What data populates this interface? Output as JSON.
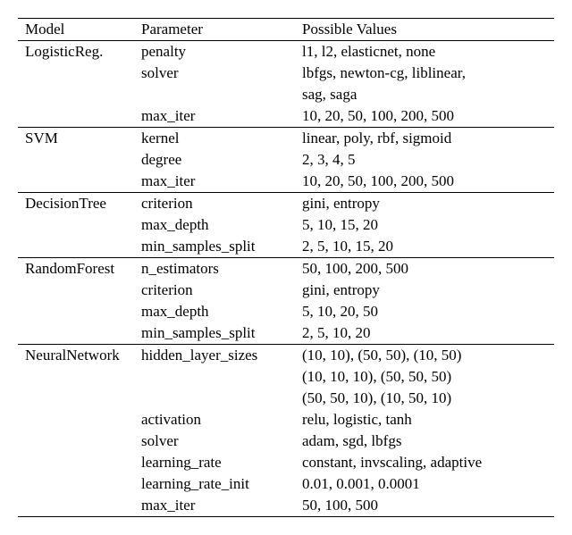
{
  "headers": {
    "model": "Model",
    "parameter": "Parameter",
    "values": "Possible Values"
  },
  "chart_data": {
    "type": "table",
    "rows": [
      {
        "model": "LogisticReg.",
        "parameter": "penalty",
        "values": "l1, l2, elasticnet, none",
        "group_start": true
      },
      {
        "model": "",
        "parameter": "solver",
        "values": "lbfgs, newton-cg, liblinear,"
      },
      {
        "model": "",
        "parameter": "",
        "values": "sag, saga"
      },
      {
        "model": "",
        "parameter": "max_iter",
        "values": "10, 20, 50, 100, 200, 500"
      },
      {
        "model": "SVM",
        "parameter": "kernel",
        "values": "linear, poly, rbf, sigmoid",
        "group_start": true
      },
      {
        "model": "",
        "parameter": "degree",
        "values": "2, 3, 4, 5"
      },
      {
        "model": "",
        "parameter": "max_iter",
        "values": "10, 20, 50, 100, 200, 500"
      },
      {
        "model": "DecisionTree",
        "parameter": "criterion",
        "values": "gini, entropy",
        "group_start": true
      },
      {
        "model": "",
        "parameter": "max_depth",
        "values": "5, 10, 15, 20"
      },
      {
        "model": "",
        "parameter": "min_samples_split",
        "values": "2, 5, 10, 15, 20"
      },
      {
        "model": "RandomForest",
        "parameter": "n_estimators",
        "values": "50, 100, 200, 500",
        "group_start": true
      },
      {
        "model": "",
        "parameter": "criterion",
        "values": "gini, entropy"
      },
      {
        "model": "",
        "parameter": "max_depth",
        "values": "5, 10, 20, 50"
      },
      {
        "model": "",
        "parameter": "min_samples_split",
        "values": "2, 5, 10, 20"
      },
      {
        "model": "NeuralNetwork",
        "parameter": "hidden_layer_sizes",
        "values": "(10, 10), (50, 50), (10, 50)",
        "group_start": true
      },
      {
        "model": "",
        "parameter": "",
        "values": "(10, 10, 10), (50, 50, 50)"
      },
      {
        "model": "",
        "parameter": "",
        "values": "(50, 50, 10), (10, 50, 10)"
      },
      {
        "model": "",
        "parameter": "activation",
        "values": "relu, logistic, tanh"
      },
      {
        "model": "",
        "parameter": "solver",
        "values": "adam, sgd, lbfgs"
      },
      {
        "model": "",
        "parameter": "learning_rate",
        "values": "constant, invscaling, adaptive"
      },
      {
        "model": "",
        "parameter": "learning_rate_init",
        "values": "0.01, 0.001, 0.0001"
      },
      {
        "model": "",
        "parameter": "max_iter",
        "values": "50, 100, 500",
        "last_row": true
      }
    ]
  }
}
